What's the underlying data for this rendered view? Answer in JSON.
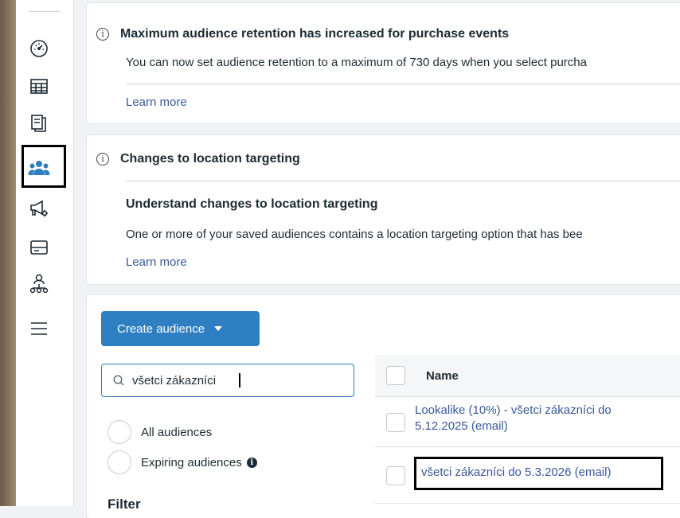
{
  "notices": [
    {
      "title": "Maximum audience retention has increased for purchase events",
      "body": "You can now set audience retention to a maximum of 730 days when you select purcha",
      "link": "Learn more"
    },
    {
      "title": "Changes to location targeting",
      "subtitle": "Understand changes to location targeting",
      "body": "One or more of your saved audiences contains a location targeting option that has bee",
      "link": "Learn more"
    }
  ],
  "toolbar": {
    "create_label": "Create audience"
  },
  "search": {
    "value": "všetci zákazníci"
  },
  "filters": {
    "all_label": "All audiences",
    "expiring_label": "Expiring audiences",
    "filter_heading": "Filter"
  },
  "table": {
    "name_header": "Name",
    "rows": [
      {
        "name_line1": "Lookalike (10%) - všetci zákazníci do",
        "name_line2": "5.12.2025 (email)"
      },
      {
        "name_line1": "všetci zákazníci do 5.3.2026 (email)"
      }
    ]
  },
  "colors": {
    "accent": "#2d7fc2",
    "link": "#385898"
  },
  "icons": [
    "performance-gauge-icon",
    "table-grid-icon",
    "documents-icon",
    "audiences-icon",
    "ad-settings-megaphone-icon",
    "billing-card-icon",
    "hierarchy-icon",
    "menu-icon"
  ]
}
